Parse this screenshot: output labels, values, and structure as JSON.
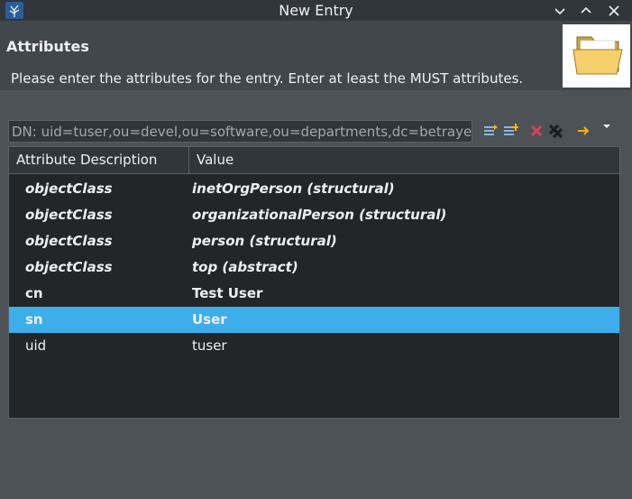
{
  "window": {
    "title": "New Entry"
  },
  "header": {
    "title": "Attributes",
    "description": "Please enter the attributes for the entry. Enter at least the MUST attributes."
  },
  "dn": {
    "value": "DN: uid=tuser,ou=devel,ou=software,ou=departments,dc=betrayer,dc=com"
  },
  "toolbar": {
    "icons": [
      "new-attribute-icon",
      "new-value-icon",
      "delete-icon",
      "delete-all-icon",
      "next-arrow-icon",
      "dropdown-icon"
    ]
  },
  "table": {
    "columns": [
      "Attribute Description",
      "Value"
    ],
    "rows": [
      {
        "attribute": "objectClass",
        "value": "inetOrgPerson (structural)",
        "style": "objectclass"
      },
      {
        "attribute": "objectClass",
        "value": "organizationalPerson (structural)",
        "style": "objectclass"
      },
      {
        "attribute": "objectClass",
        "value": "person (structural)",
        "style": "objectclass"
      },
      {
        "attribute": "objectClass",
        "value": "top (abstract)",
        "style": "objectclass"
      },
      {
        "attribute": "cn",
        "value": "Test User",
        "style": "must"
      },
      {
        "attribute": "sn",
        "value": "User",
        "style": "must",
        "selected": true
      },
      {
        "attribute": "uid",
        "value": "tuser",
        "style": "may"
      }
    ]
  },
  "colors": {
    "selection": "#3daee9",
    "background": "#4d5257",
    "table_background": "#232629",
    "delete_red": "#da4453",
    "arrow_yellow": "#f6b500"
  }
}
